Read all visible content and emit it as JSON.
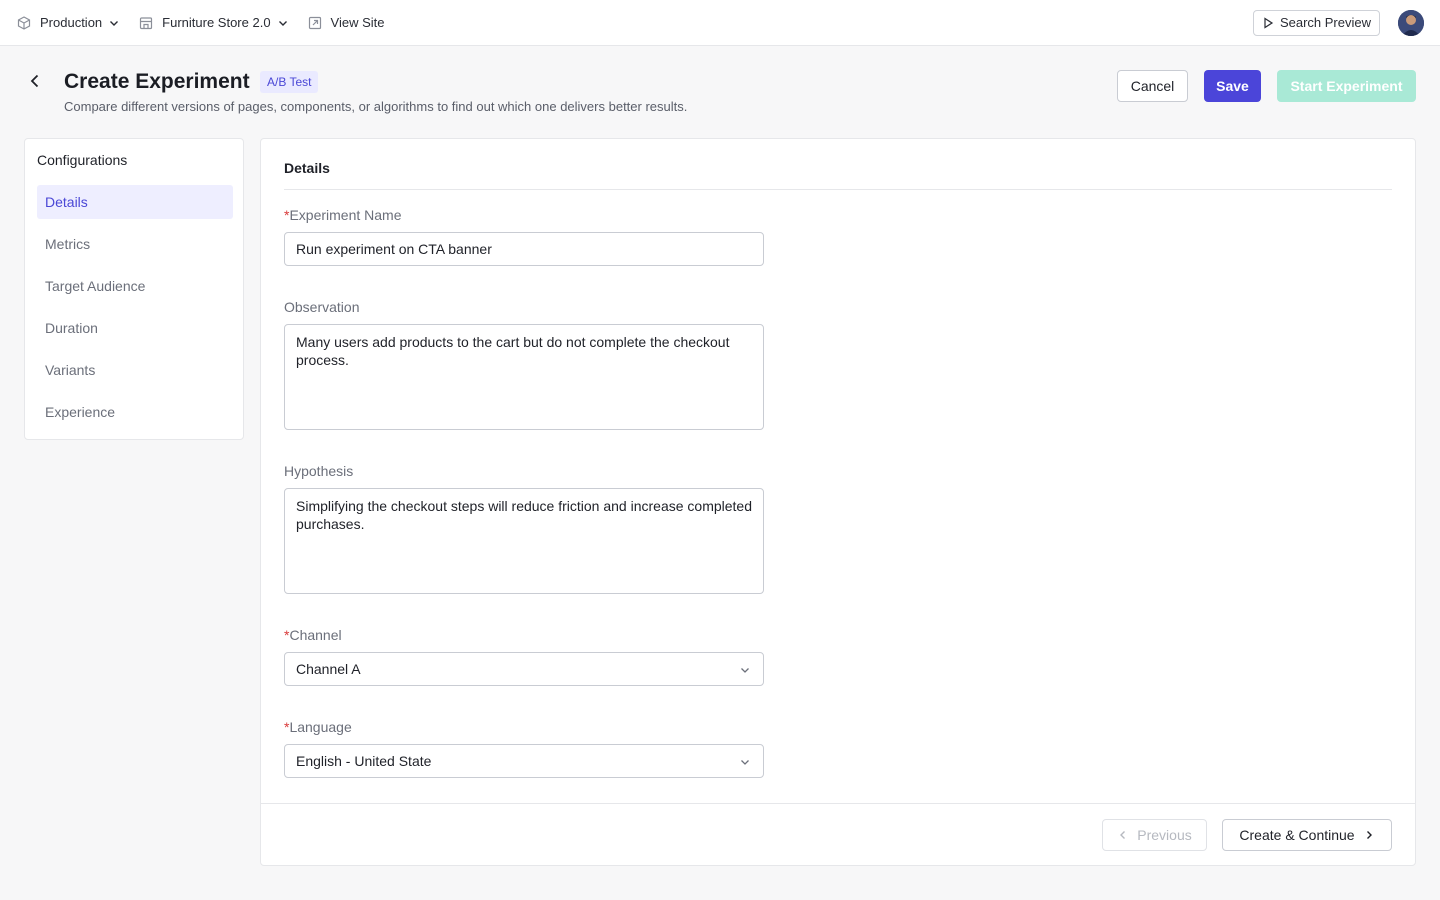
{
  "topbar": {
    "environment": {
      "label": "Production",
      "icon": "cube-icon"
    },
    "site": {
      "label": "Furniture Store 2.0",
      "icon": "store-icon"
    },
    "view_site": {
      "label": "View Site",
      "icon": "external-link-icon"
    },
    "search_preview": {
      "label": "Search Preview",
      "icon": "play-icon"
    }
  },
  "header": {
    "title": "Create Experiment",
    "badge": "A/B Test",
    "subtitle": "Compare different versions of pages, components, or algorithms to find out which one delivers better results.",
    "cancel_label": "Cancel",
    "save_label": "Save",
    "start_label": "Start Experiment"
  },
  "sidebar": {
    "title": "Configurations",
    "items": [
      {
        "label": "Details",
        "active": true
      },
      {
        "label": "Metrics",
        "active": false
      },
      {
        "label": "Target Audience",
        "active": false
      },
      {
        "label": "Duration",
        "active": false
      },
      {
        "label": "Variants",
        "active": false
      },
      {
        "label": "Experience",
        "active": false
      }
    ]
  },
  "form": {
    "section_title": "Details",
    "experiment_name": {
      "label": "Experiment Name",
      "required": true,
      "value": "Run experiment on CTA banner"
    },
    "observation": {
      "label": "Observation",
      "required": false,
      "value": "Many users add products to the cart but do not complete the checkout process."
    },
    "hypothesis": {
      "label": "Hypothesis",
      "required": false,
      "value": "Simplifying the checkout steps will reduce friction and increase completed purchases."
    },
    "channel": {
      "label": "Channel",
      "required": true,
      "value": "Channel A"
    },
    "language": {
      "label": "Language",
      "required": true,
      "value": "English - United State"
    }
  },
  "footer": {
    "previous_label": "Previous",
    "next_label": "Create & Continue"
  },
  "colors": {
    "accent": "#4b45d9",
    "start_disabled": "#a9e9d6",
    "required": "#d93a3a"
  }
}
